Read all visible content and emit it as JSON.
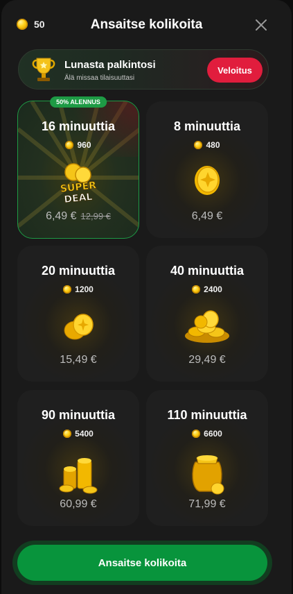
{
  "header": {
    "balance": "50",
    "title": "Ansaitse kolikoita",
    "close_icon": "close-icon"
  },
  "promo": {
    "title": "Lunasta palkintosi",
    "subtitle": "Älä missaa tilaisuuttasi",
    "button": "Veloitus",
    "icon": "trophy-icon"
  },
  "packs": [
    {
      "title": "16 minuuttia",
      "coins": "960",
      "price": "6,49 €",
      "old_price": "12,99 €",
      "badge": "50% ALENNUS",
      "super_top": "SUPER",
      "super_bottom": "DEAL",
      "icon": "super-deal-icon"
    },
    {
      "title": "8 minuuttia",
      "coins": "480",
      "price": "6,49 €",
      "icon": "single-coin-icon"
    },
    {
      "title": "20 minuuttia",
      "coins": "1200",
      "price": "15,49 €",
      "icon": "two-coins-icon"
    },
    {
      "title": "40 minuuttia",
      "coins": "2400",
      "price": "29,49 €",
      "icon": "coin-pile-icon"
    },
    {
      "title": "90 minuuttia",
      "coins": "5400",
      "price": "60,99 €",
      "icon": "coin-stacks-icon"
    },
    {
      "title": "110 minuuttia",
      "coins": "6600",
      "price": "71,99 €",
      "icon": "coin-sack-icon"
    }
  ],
  "cta": {
    "label": "Ansaitse kolikoita"
  },
  "colors": {
    "accent_green": "#08943c",
    "promo_red": "#e11d3d",
    "coin_gold": "#ffd21a"
  }
}
